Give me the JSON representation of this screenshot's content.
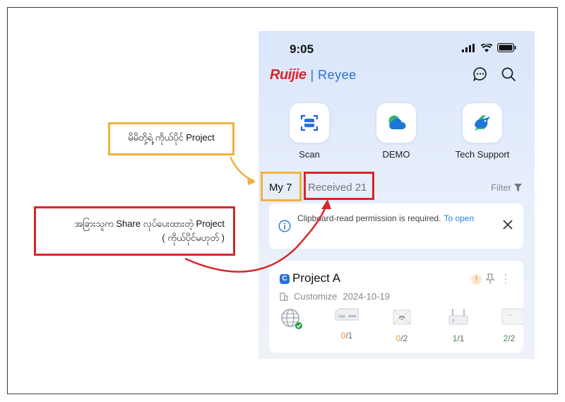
{
  "status_bar": {
    "time": "9:05"
  },
  "brand": {
    "name_a": "Ruijie",
    "name_b": "Reyee"
  },
  "quick_actions": [
    {
      "label": "Scan",
      "icon": "scan-icon"
    },
    {
      "label": "DEMO",
      "icon": "cloud-icon"
    },
    {
      "label": "Tech Support",
      "icon": "support-bird-icon"
    }
  ],
  "tabs": {
    "my": "My 7",
    "received": "Received 21",
    "filter": "Filter"
  },
  "notice": {
    "text": "Clipboard-read permission is required.",
    "link": "To open"
  },
  "project": {
    "logo": "C",
    "name": "Project A",
    "type": "Customize",
    "date": "2024-10-19",
    "devices": [
      {
        "icon": "switch-icon",
        "online": "0",
        "total": "/1",
        "color": "#e39b2b"
      },
      {
        "icon": "router-icon",
        "online": "0",
        "total": "/2",
        "color": "#e39b2b"
      },
      {
        "icon": "ap-icon",
        "online": "1",
        "total": "/1",
        "color": "#2aa14a"
      },
      {
        "icon": "gateway-icon",
        "online": "2",
        "total": "/2",
        "color": "#2aa14a"
      }
    ]
  },
  "callouts": {
    "my_projects": "မိမိတို့ရဲ့ ကိုယ်ပိုင် Project",
    "shared_line1": "အခြားသူက Share လုပ်ပေးထားတဲ့ Project",
    "shared_line2": "( ကိုယ်ပိုင်မဟုတ် )"
  },
  "colors": {
    "highlight_yellow": "#f0b23f",
    "highlight_red": "#d7262c",
    "accent_blue": "#2a6fdb"
  }
}
